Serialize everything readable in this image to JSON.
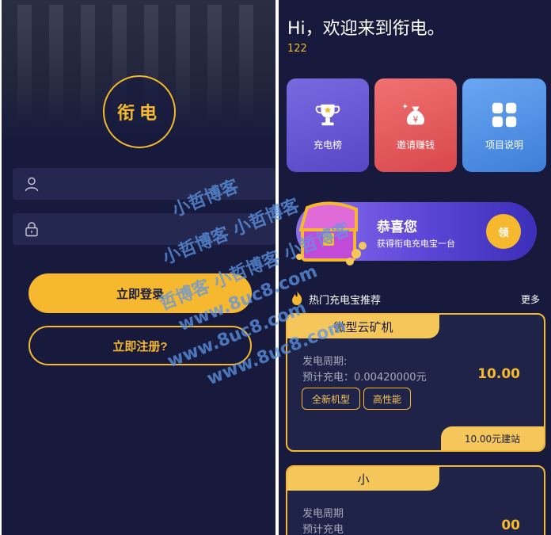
{
  "login": {
    "logo_text": "衔电",
    "username_placeholder": "",
    "password_placeholder": "",
    "login_label": "立即登录",
    "register_label": "立即注册?"
  },
  "home": {
    "greeting": "Hi，欢迎来到衔电。",
    "greeting_number": "122",
    "tiles": [
      {
        "label": "充电榜",
        "icon": "trophy-icon"
      },
      {
        "label": "邀请赚钱",
        "icon": "money-bag-icon"
      },
      {
        "label": "项目说明",
        "icon": "grid-icon"
      }
    ],
    "banner": {
      "title": "恭喜您",
      "subtitle": "获得衔电充电宝一台",
      "claim_label": "领"
    },
    "section": {
      "title": "热门充电宝推荐",
      "more": "更多"
    },
    "cards": [
      {
        "name": "微型云矿机",
        "period_label": "发电周期:",
        "forecast_label": "预计充电：0.00420000元",
        "price": "10.00",
        "tags": [
          "全新机型",
          "高性能"
        ],
        "footer": "10.00元建站"
      },
      {
        "name": "小",
        "period_label": "发电周期",
        "forecast_label": "预计充电",
        "price": "00"
      }
    ]
  },
  "watermark": {
    "lines": [
      "小哲博客",
      "小哲博客 小哲博客",
      "哲博客 小哲博客 小哲博客",
      "www.8uc8.com",
      "www.8uc8.com",
      "www.8uc8.com"
    ]
  },
  "colors": {
    "accent": "#f5b82e",
    "bg": "#171a3d",
    "field": "#242850"
  }
}
